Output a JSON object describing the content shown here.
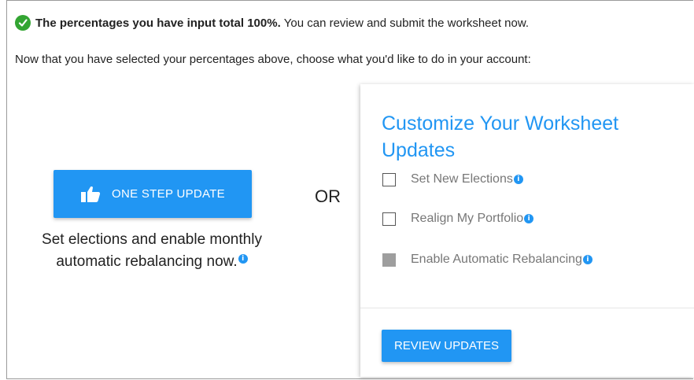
{
  "status": {
    "bold": "The percentages you have input total 100%.",
    "rest": "You can review and submit the worksheet now."
  },
  "instruction": "Now that you have selected your percentages above, choose what you'd like to do in your account:",
  "one_step": {
    "button_label": "ONE STEP UPDATE",
    "description": "Set elections and enable monthly automatic rebalancing now."
  },
  "or_label": "OR",
  "customize": {
    "title": "Customize Your Worksheet Updates",
    "options": [
      {
        "label": "Set New Elections",
        "checked": false,
        "disabled": false
      },
      {
        "label": "Realign My Portfolio",
        "checked": false,
        "disabled": false
      },
      {
        "label": "Enable Automatic Rebalancing",
        "checked": false,
        "disabled": true
      }
    ],
    "review_label": "REVIEW UPDATES"
  },
  "colors": {
    "accent": "#2196f3",
    "success": "#33a532",
    "disabled": "#9e9e9e"
  },
  "icons": {
    "status": "check-circle-icon",
    "button": "thumbs-up-icon",
    "info": "info-icon"
  }
}
